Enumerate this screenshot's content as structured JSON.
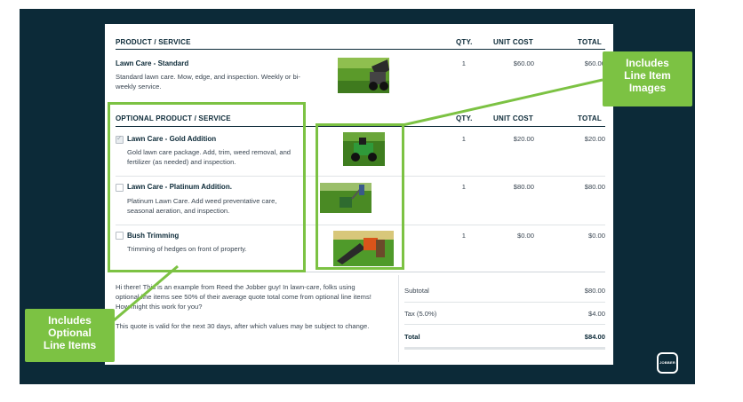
{
  "table": {
    "headers": {
      "product": "PRODUCT / SERVICE",
      "qty": "QTY.",
      "unit_cost": "UNIT COST",
      "total": "TOTAL"
    },
    "items": [
      {
        "title": "Lawn Care - Standard",
        "desc_line1": "Standard lawn care. Mow, edge, and inspection. Weekly or bi-",
        "desc_line2": "weekly service.",
        "qty": "1",
        "unit_cost": "$60.00",
        "total": "$60.00",
        "image": "lawn-mower-photo"
      }
    ]
  },
  "optional": {
    "headers": {
      "product": "OPTIONAL PRODUCT / SERVICE",
      "qty": "QTY.",
      "unit_cost": "UNIT COST",
      "total": "TOTAL"
    },
    "items": [
      {
        "title": "Lawn Care - Gold Addition",
        "desc_line1": "Gold lawn care package. Add, trim, weed removal, and",
        "desc_line2": "fertilizer (as needed) and inspection.",
        "qty": "1",
        "unit_cost": "$20.00",
        "total": "$20.00",
        "checked": true,
        "image": "riding-mower-photo"
      },
      {
        "title": "Lawn Care - Platinum Addition.",
        "desc_line1": "Platinum Lawn Care. Add weed preventative care,",
        "desc_line2": "seasonal aeration, and inspection.",
        "qty": "1",
        "unit_cost": "$80.00",
        "total": "$80.00",
        "checked": false,
        "image": "fertilizer-spreader-photo"
      },
      {
        "title": "Bush Trimming",
        "desc_line1": "Trimming of hedges on front of property.",
        "desc_line2": "",
        "qty": "1",
        "unit_cost": "$0.00",
        "total": "$0.00",
        "checked": false,
        "image": "hedge-trimmer-photo"
      }
    ]
  },
  "message": {
    "line1": "Hi there! This is an example from Reed the Jobber guy! In lawn-care, folks using",
    "line2": "optional line items see 50% of their average quote total come from optional line items!",
    "line3": "How might this work for you?",
    "line4": "This quote is valid for the next 30 days, after which values may be subject to change."
  },
  "summary": {
    "subtotal_label": "Subtotal",
    "subtotal_value": "$80.00",
    "tax_label": "Tax (5.0%)",
    "tax_value": "$4.00",
    "total_label": "Total",
    "total_value": "$84.00"
  },
  "callouts": {
    "images_line1": "Includes",
    "images_line2": "Line Item",
    "images_line3": "Images",
    "optional_line1": "Includes",
    "optional_line2": "Optional",
    "optional_line3": "Line Items"
  },
  "brand": {
    "logo_text": "JOBBER",
    "accent": "#7cc243",
    "navy": "#0c2a38"
  }
}
